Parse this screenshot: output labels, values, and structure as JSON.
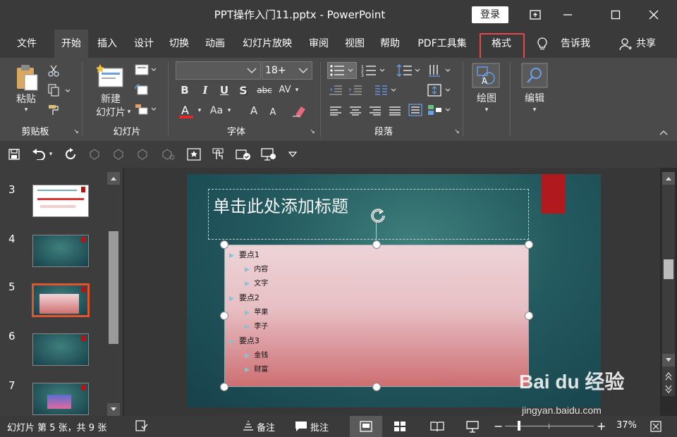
{
  "window": {
    "title": "PPT操作入门11.pptx  -  PowerPoint",
    "login_label": "登录"
  },
  "menu": {
    "tabs": [
      "文件",
      "开始",
      "插入",
      "设计",
      "切换",
      "动画",
      "幻灯片放映",
      "审阅",
      "视图",
      "帮助",
      "PDF工具集",
      "格式"
    ],
    "tell_me": "告诉我",
    "share": "共享"
  },
  "ribbon": {
    "clipboard": {
      "paste": "粘贴",
      "label": "剪贴板"
    },
    "slides": {
      "new_line1": "新建",
      "new_line2": "幻灯片",
      "label": "幻灯片"
    },
    "font": {
      "font_size": "18+",
      "bold": "B",
      "italic": "I",
      "underline": "U",
      "shadow": "S",
      "strike": "abc",
      "spacing": "AV",
      "aa": "Aa",
      "grow": "A",
      "shrink": "A",
      "label": "字体",
      "color": "#e3262b"
    },
    "paragraph": {
      "label": "段落"
    },
    "drawing": {
      "label": "绘图"
    },
    "editing": {
      "label": "编辑"
    }
  },
  "thumbnails": [
    {
      "num": "3"
    },
    {
      "num": "4"
    },
    {
      "num": "5"
    },
    {
      "num": "6"
    },
    {
      "num": "7"
    }
  ],
  "slide": {
    "title_placeholder": "单击此处添加标题",
    "items": [
      {
        "text": "要点1",
        "sub": [
          "内容",
          "文字"
        ]
      },
      {
        "text": "要点2",
        "sub": [
          "苹果",
          "李子"
        ]
      },
      {
        "text": "要点3",
        "sub": [
          "金钱",
          "财富"
        ]
      }
    ]
  },
  "status": {
    "slide_info": "幻灯片 第 5 张，共 9 张",
    "notes": "备注",
    "comments": "批注",
    "zoom": "37%"
  },
  "watermark": {
    "brand": "Bai du 经验",
    "url": "jingyan.baidu.com"
  },
  "colors": {
    "accent_red": "#e5474b",
    "selected_thumb": "#e2552b"
  }
}
